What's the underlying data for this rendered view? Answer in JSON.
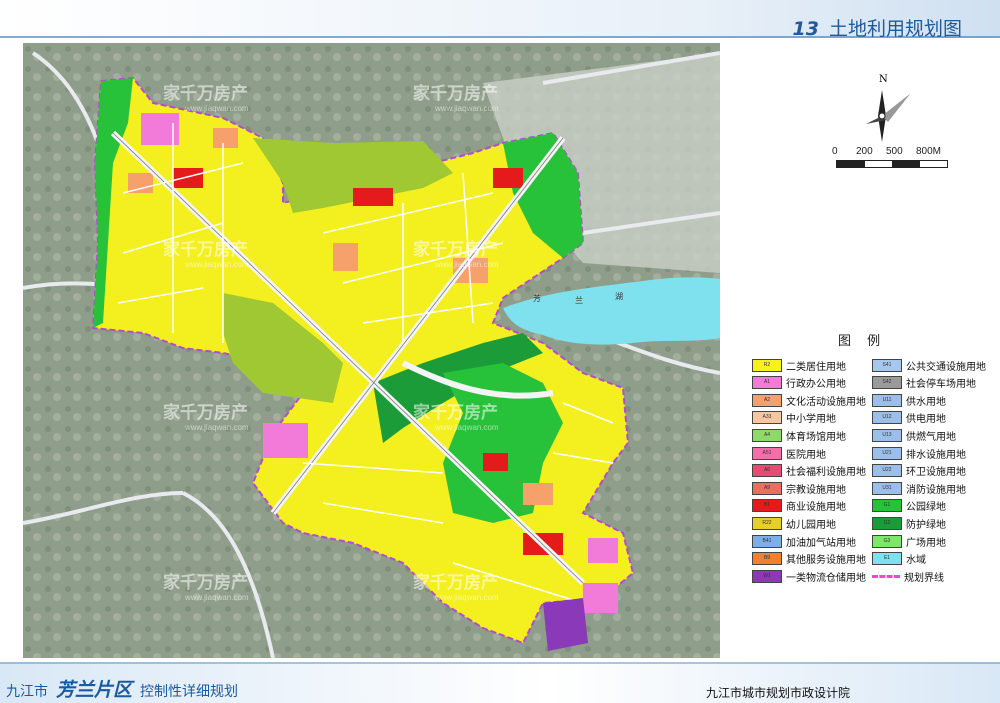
{
  "header": {
    "number": "13",
    "title": "土地利用规划图"
  },
  "compass": {
    "north": "N"
  },
  "scale": {
    "ticks": [
      "0",
      "200",
      "500",
      "800M"
    ]
  },
  "map": {
    "lake_chars": [
      "芳",
      "兰",
      "湖"
    ],
    "watermark": {
      "brand": "家千万房产",
      "url": "www.jiaqwan.com"
    }
  },
  "legend": {
    "title": "图 例",
    "left": [
      {
        "code": "R2",
        "label": "二类居住用地",
        "color": "#f7f21c"
      },
      {
        "code": "A1",
        "label": "行政办公用地",
        "color": "#f27bd9"
      },
      {
        "code": "A2",
        "label": "文化活动设施用地",
        "color": "#f6a06c"
      },
      {
        "code": "A33",
        "label": "中小学用地",
        "color": "#f8c7a2"
      },
      {
        "code": "A4",
        "label": "体育场馆用地",
        "color": "#8fd86a"
      },
      {
        "code": "A51",
        "label": "医院用地",
        "color": "#f26faa"
      },
      {
        "code": "A6",
        "label": "社会福利设施用地",
        "color": "#e24d73"
      },
      {
        "code": "A9",
        "label": "宗教设施用地",
        "color": "#e96f62"
      },
      {
        "code": "B1",
        "label": "商业设施用地",
        "color": "#e51a1a"
      },
      {
        "code": "R22",
        "label": "幼儿园用地",
        "color": "#e8cf27"
      },
      {
        "code": "B41",
        "label": "加油加气站用地",
        "color": "#7daee6"
      },
      {
        "code": "B9",
        "label": "其他服务设施用地",
        "color": "#f0812e"
      },
      {
        "code": "W1",
        "label": "一类物流仓储用地",
        "color": "#8a3ab8"
      }
    ],
    "right": [
      {
        "code": "S41",
        "label": "公共交通设施用地",
        "color": "#a7c8ee"
      },
      {
        "code": "S42",
        "label": "社会停车场用地",
        "color": "#9a9a9a"
      },
      {
        "code": "U11",
        "label": "供水用地",
        "color": "#9bbfe8"
      },
      {
        "code": "U12",
        "label": "供电用地",
        "color": "#9bbfe8"
      },
      {
        "code": "U13",
        "label": "供燃气用地",
        "color": "#9bbfe8"
      },
      {
        "code": "U21",
        "label": "排水设施用地",
        "color": "#9bbfe8"
      },
      {
        "code": "U22",
        "label": "环卫设施用地",
        "color": "#9bbfe8"
      },
      {
        "code": "U31",
        "label": "消防设施用地",
        "color": "#9bbfe8"
      },
      {
        "code": "G1",
        "label": "公园绿地",
        "color": "#28c23a"
      },
      {
        "code": "G2",
        "label": "防护绿地",
        "color": "#1c9c38"
      },
      {
        "code": "G3",
        "label": "广场用地",
        "color": "#7ee66a"
      },
      {
        "code": "E1",
        "label": "水域",
        "color": "#7fe0ee"
      },
      {
        "code": "",
        "label": "规划界线",
        "color": "#ff44cc"
      }
    ]
  },
  "footer": {
    "city": "九江市",
    "district": "芳兰片区",
    "plan": "控制性详细规划",
    "institute": "九江市城市规划市政设计院"
  }
}
